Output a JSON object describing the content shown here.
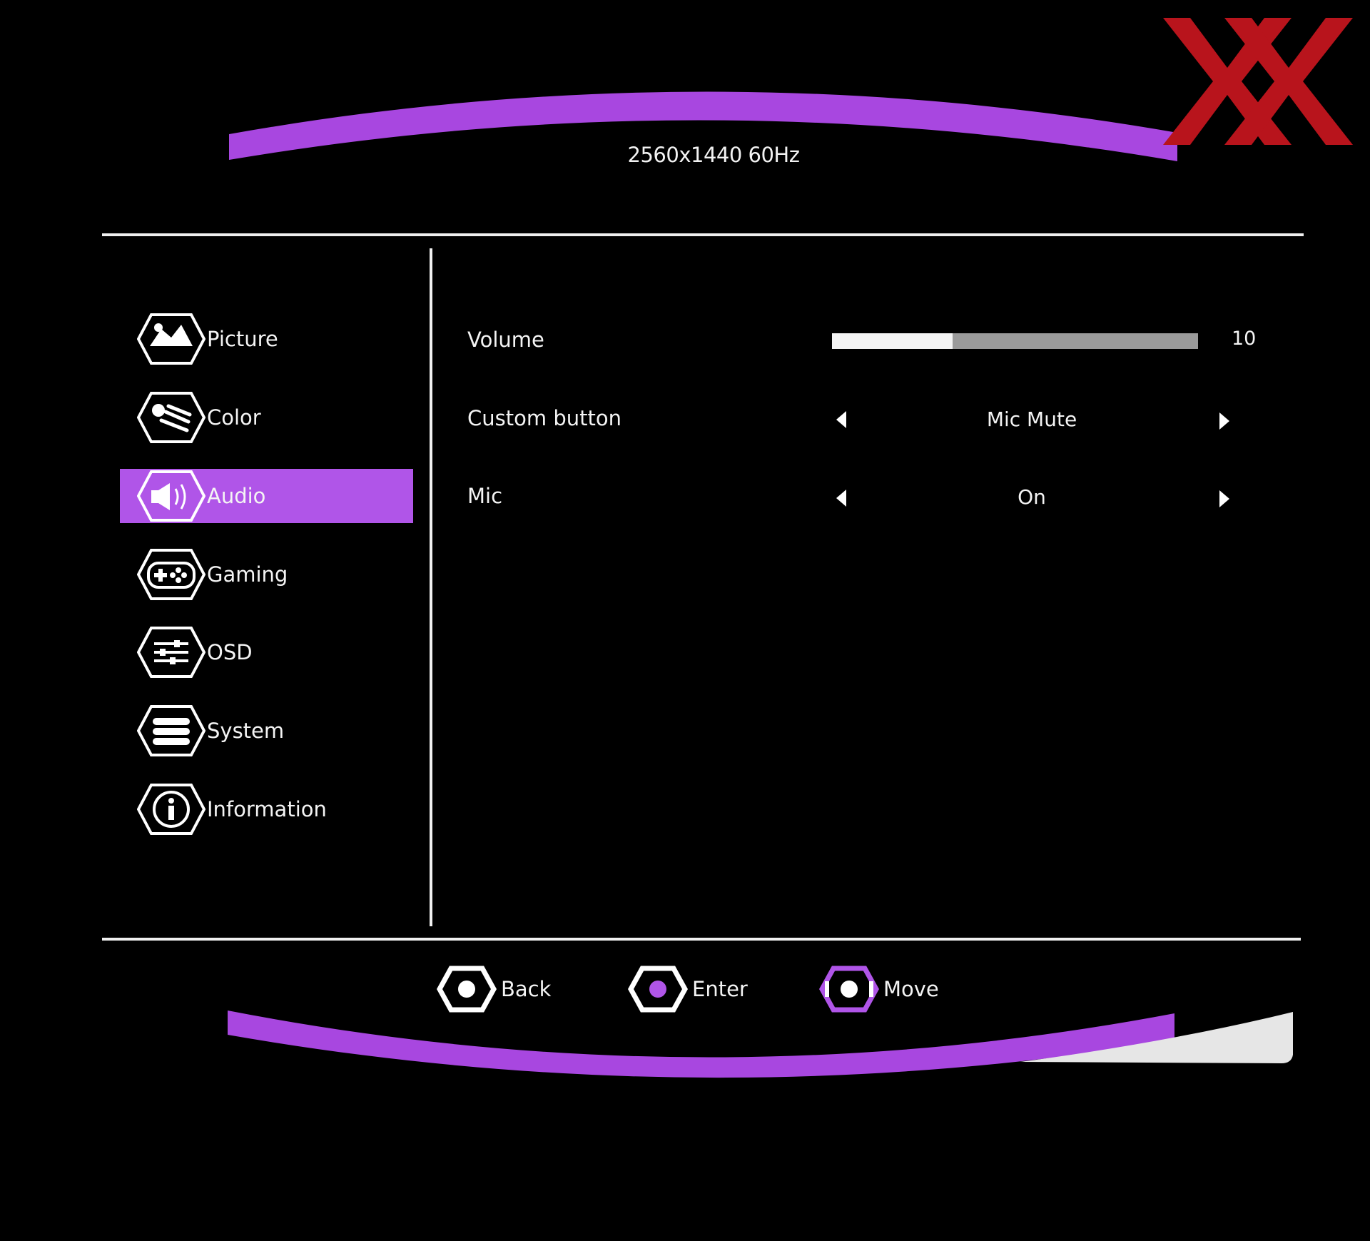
{
  "header": {
    "resolution": "2560x1440 60Hz"
  },
  "sidebar": {
    "items": [
      {
        "label": "Picture",
        "icon": "picture-icon",
        "active": false
      },
      {
        "label": "Color",
        "icon": "color-icon",
        "active": false
      },
      {
        "label": "Audio",
        "icon": "audio-icon",
        "active": true
      },
      {
        "label": "Gaming",
        "icon": "gaming-icon",
        "active": false
      },
      {
        "label": "OSD",
        "icon": "osd-icon",
        "active": false
      },
      {
        "label": "System",
        "icon": "system-icon",
        "active": false
      },
      {
        "label": "Information",
        "icon": "information-icon",
        "active": false
      }
    ]
  },
  "content": {
    "volume": {
      "label": "Volume",
      "value": "10",
      "level_fraction": 0.33
    },
    "custom_button": {
      "label": "Custom button",
      "value": "Mic Mute"
    },
    "mic": {
      "label": "Mic",
      "value": "On"
    }
  },
  "footer": {
    "back": "Back",
    "enter": "Enter",
    "move": "Move"
  },
  "colors": {
    "accent": "#b055e8",
    "background": "#000000",
    "logo_red": "#b8141c"
  }
}
